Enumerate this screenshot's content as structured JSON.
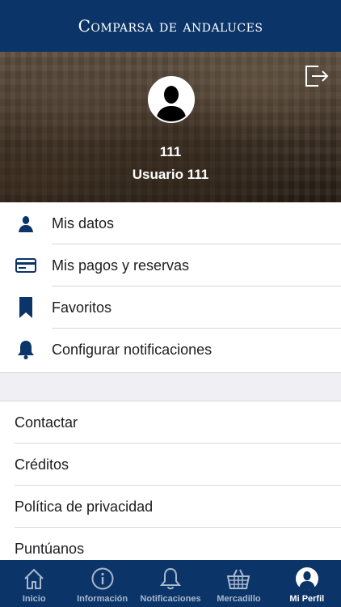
{
  "header": {
    "title": "Comparsa de andaluces"
  },
  "profile": {
    "id": "111",
    "username": "Usuario 111"
  },
  "menu": [
    {
      "label": "Mis datos",
      "icon": "person-icon"
    },
    {
      "label": "Mis pagos y reservas",
      "icon": "credit-card-icon"
    },
    {
      "label": "Favoritos",
      "icon": "bookmark-icon"
    },
    {
      "label": "Configurar notificaciones",
      "icon": "bell-icon"
    }
  ],
  "links": [
    {
      "label": "Contactar"
    },
    {
      "label": "Créditos"
    },
    {
      "label": "Política de privacidad"
    },
    {
      "label": "Puntúanos"
    }
  ],
  "tabs": [
    {
      "label": "Inicio",
      "icon": "home-icon"
    },
    {
      "label": "Información",
      "icon": "info-icon"
    },
    {
      "label": "Notificaciones",
      "icon": "bell-icon"
    },
    {
      "label": "Mercadillo",
      "icon": "basket-icon"
    },
    {
      "label": "Mi Perfil",
      "icon": "profile-icon",
      "active": true
    }
  ],
  "colors": {
    "primary": "#0b3569",
    "tab_inactive": "#aab8cc",
    "separator": "#d8d8d8",
    "gap": "#efeff4"
  }
}
